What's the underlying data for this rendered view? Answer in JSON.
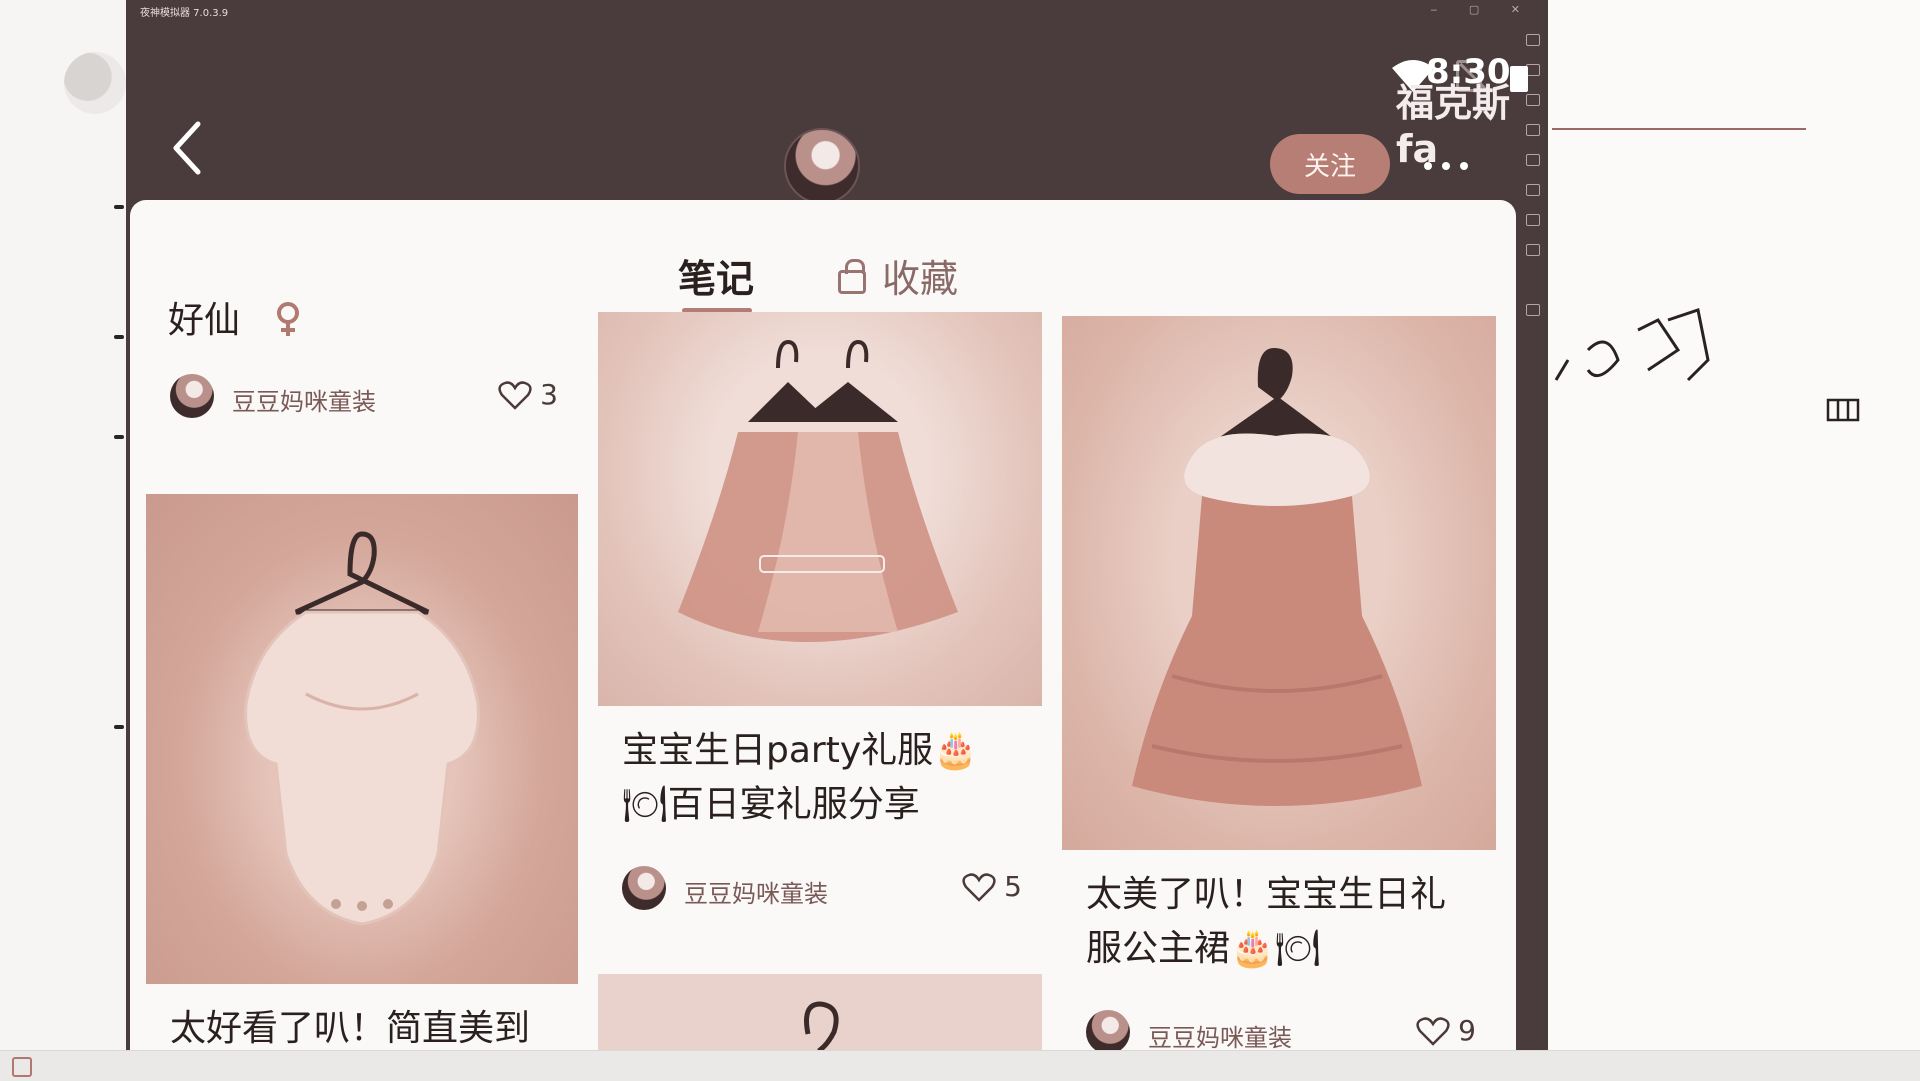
{
  "emulator": {
    "title": "夜神模拟器 7.0.3.9"
  },
  "status_bar": {
    "time": "8:30",
    "overlay_text": "福克斯fa"
  },
  "profile_header": {
    "follow_label": "关注"
  },
  "tabs": [
    {
      "label": "笔记",
      "active": true
    },
    {
      "label": "收藏",
      "active": false,
      "locked": true
    }
  ],
  "notes": [
    {
      "title": "好仙",
      "author": "豆豆妈咪童装",
      "likes": "3"
    },
    {
      "title": "太好看了叭！简直美到",
      "author": "",
      "likes": ""
    },
    {
      "title": "宝宝生日party礼服🎂🍽百日宴礼服分享",
      "title_line1": "宝宝生日party礼服🎂",
      "title_line2": "🍽百日宴礼服分享",
      "author": "豆豆妈咪童装",
      "likes": "5"
    },
    {
      "title": "太美了叭！宝宝生日礼服公主裙🎂🍽",
      "title_line1": "太美了叭！宝宝生日礼",
      "title_line2": "服公主裙🎂🍽",
      "author": "豆豆妈咪童装",
      "likes": "9"
    }
  ],
  "colors": {
    "accent": "#b67e74",
    "status_bar_bg": "#4a3b3d",
    "image_tint": "#d9a89c"
  }
}
